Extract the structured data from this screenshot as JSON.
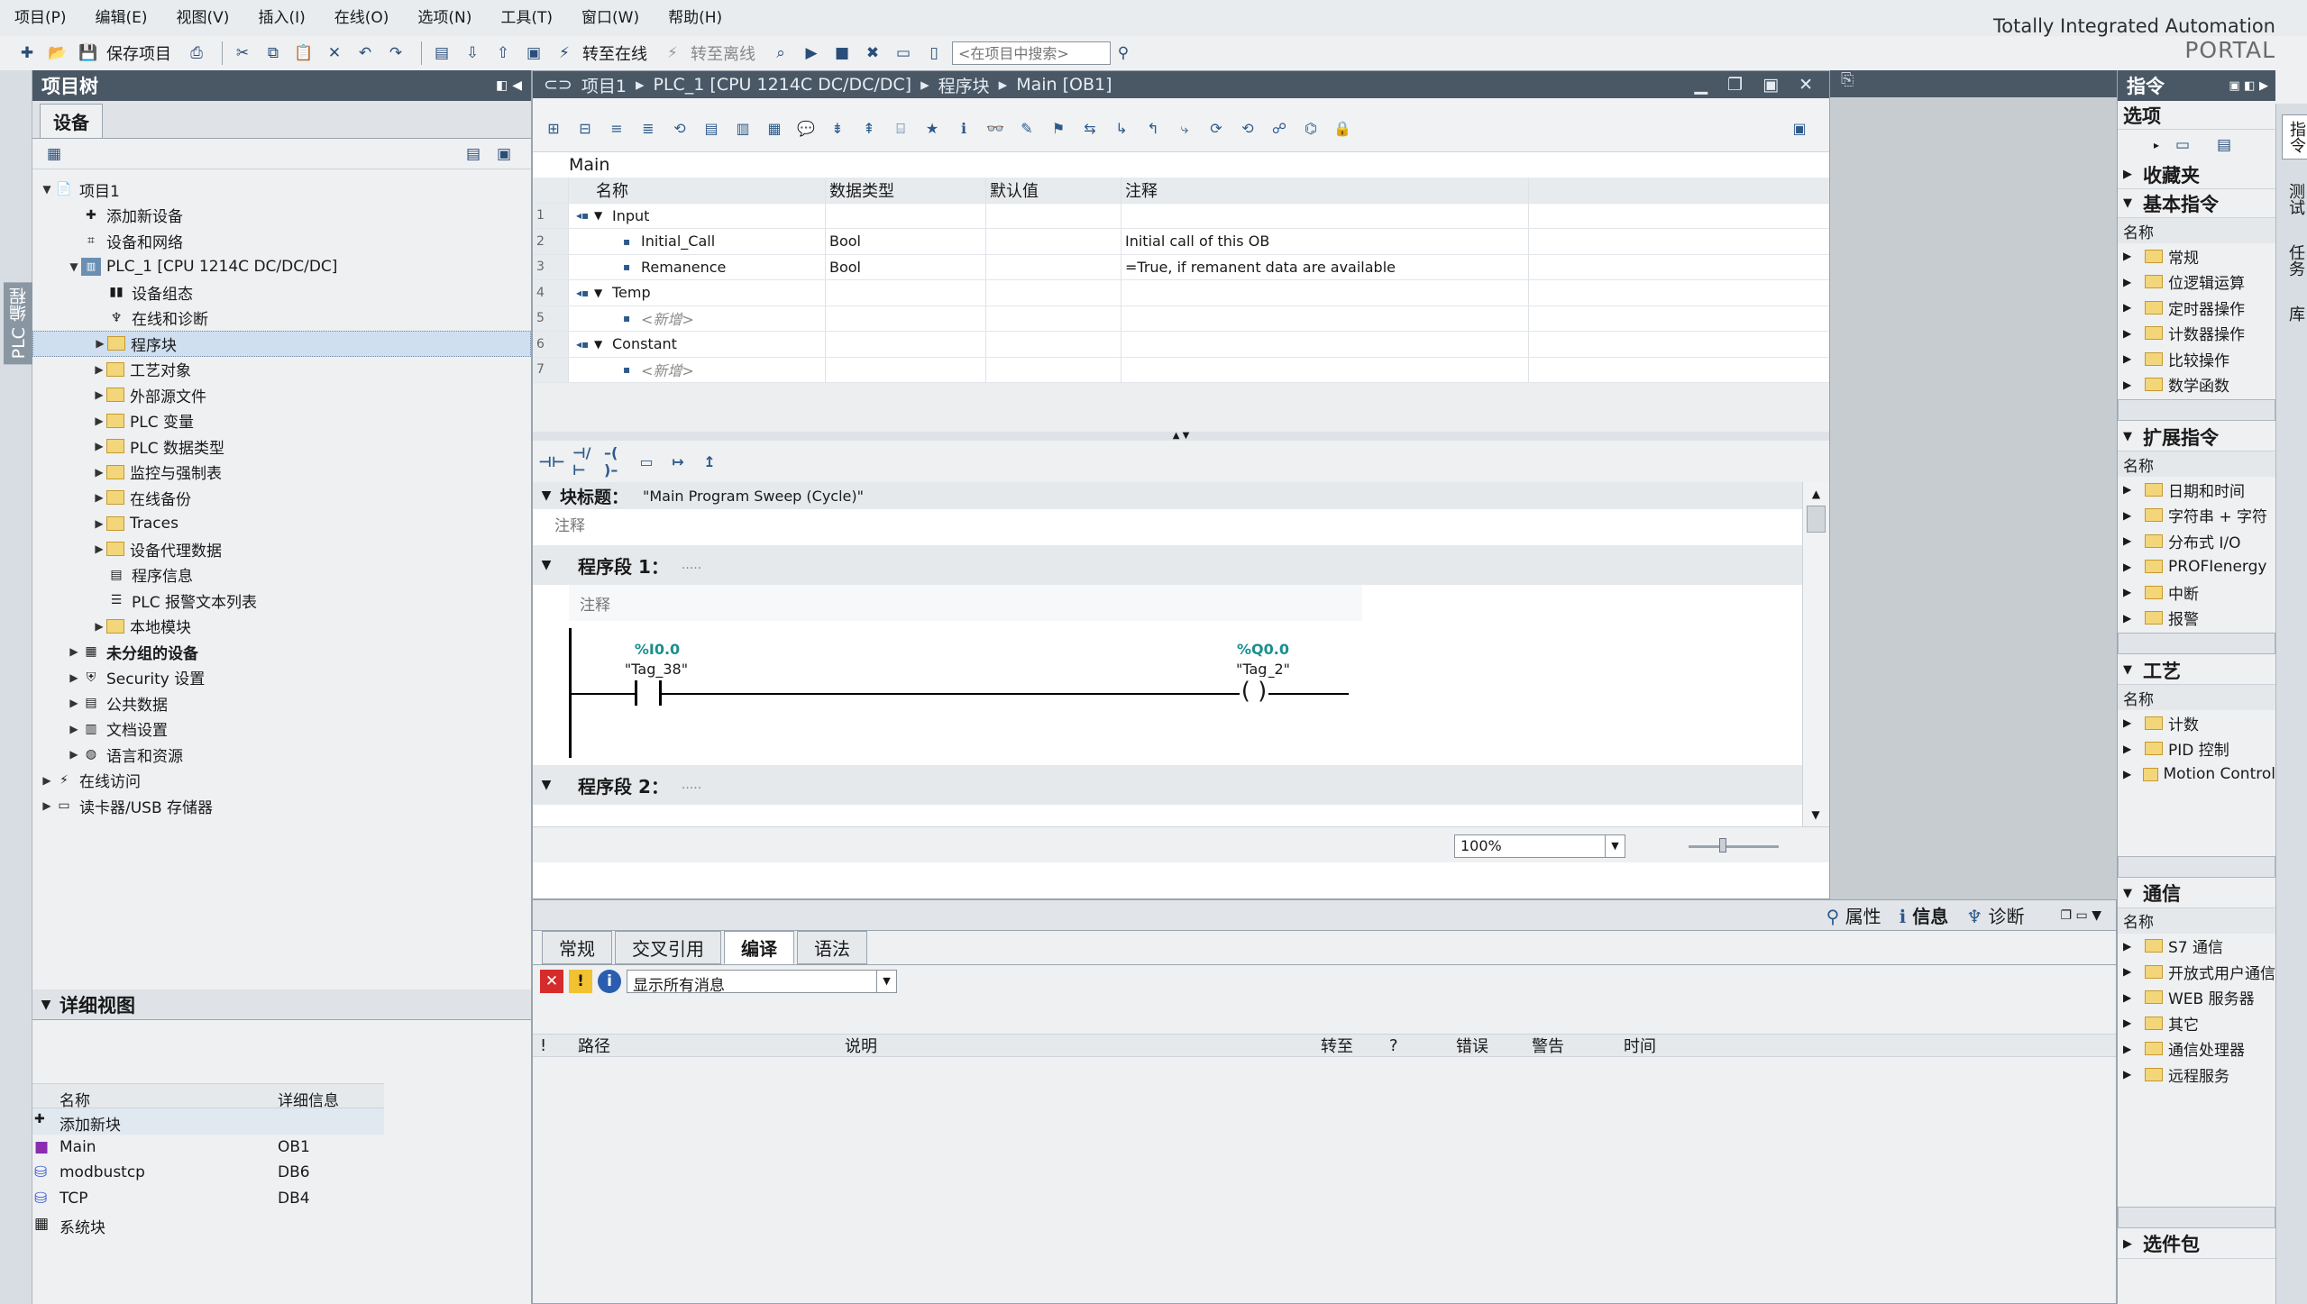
{
  "menu": [
    "项目(P)",
    "编辑(E)",
    "视图(V)",
    "插入(I)",
    "在线(O)",
    "选项(N)",
    "工具(T)",
    "窗口(W)",
    "帮助(H)"
  ],
  "brand": {
    "line1": "Totally Integrated Automation",
    "line2": "PORTAL"
  },
  "toolbar": {
    "save_label": "保存项目",
    "go_online": "转至在线",
    "go_offline": "转至离线",
    "search_placeholder": "<在项目中搜索>"
  },
  "side_strip_label": "PLC 编程",
  "project_tree": {
    "title": "项目树",
    "tab": "设备",
    "items": [
      "项目1",
      "添加新设备",
      "设备和网络",
      "PLC_1 [CPU 1214C DC/DC/DC]",
      "设备组态",
      "在线和诊断",
      "程序块",
      "工艺对象",
      "外部源文件",
      "PLC 变量",
      "PLC 数据类型",
      "监控与强制表",
      "在线备份",
      "Traces",
      "设备代理数据",
      "程序信息",
      "PLC 报警文本列表",
      "本地模块",
      "未分组的设备",
      "Security 设置",
      "公共数据",
      "文档设置",
      "语言和资源",
      "在线访问",
      "读卡器/USB 存储器"
    ]
  },
  "detail_view": {
    "title": "详细视图",
    "col_name": "名称",
    "col_info": "详细信息",
    "rows": [
      {
        "name": "添加新块",
        "info": ""
      },
      {
        "name": "Main",
        "info": "OB1"
      },
      {
        "name": "modbustcp",
        "info": "DB6"
      },
      {
        "name": "TCP",
        "info": "DB4"
      },
      {
        "name": "系统块",
        "info": ""
      }
    ]
  },
  "editor": {
    "breadcrumb": [
      "项目1",
      "PLC_1 [CPU 1214C DC/DC/DC]",
      "程序块",
      "Main [OB1]"
    ],
    "block_name": "Main",
    "columns": [
      "名称",
      "数据类型",
      "默认值",
      "注释"
    ],
    "rows": [
      {
        "n": "1",
        "name": "Input",
        "type": "",
        "default": "",
        "comment": ""
      },
      {
        "n": "2",
        "name": "Initial_Call",
        "type": "Bool",
        "default": "",
        "comment": "Initial call of this OB"
      },
      {
        "n": "3",
        "name": "Remanence",
        "type": "Bool",
        "default": "",
        "comment": "=True, if remanent data are available"
      },
      {
        "n": "4",
        "name": "Temp",
        "type": "",
        "default": "",
        "comment": ""
      },
      {
        "n": "5",
        "name": "<新增>",
        "type": "",
        "default": "",
        "comment": ""
      },
      {
        "n": "6",
        "name": "Constant",
        "type": "",
        "default": "",
        "comment": ""
      },
      {
        "n": "7",
        "name": "<新增>",
        "type": "",
        "default": "",
        "comment": ""
      }
    ],
    "block_title_label": "块标题：",
    "block_title": "\"Main Program Sweep (Cycle)\"",
    "comment": "注释",
    "network1": "程序段 1：",
    "network1_dots": ".....",
    "network2": "程序段 2：",
    "network2_dots": ".....",
    "contact_addr": "%I0.0",
    "contact_tag": "\"Tag_38\"",
    "coil_addr": "%Q0.0",
    "coil_tag": "\"Tag_2\"",
    "zoom": "100%"
  },
  "inspector": {
    "right_tabs": [
      "属性",
      "信息",
      "诊断"
    ],
    "tabs": [
      "常规",
      "交叉引用",
      "编译",
      "语法"
    ],
    "active_tab": "编译",
    "filter": "显示所有消息",
    "columns": [
      "!",
      "路径",
      "说明",
      "转至",
      "?",
      "错误",
      "警告",
      "时间"
    ]
  },
  "instructions": {
    "title": "指令",
    "options": "选项",
    "favorites": "收藏夹",
    "basic": {
      "title": "基本指令",
      "col": "名称",
      "items": [
        "常规",
        "位逻辑运算",
        "定时器操作",
        "计数器操作",
        "比较操作",
        "数学函数"
      ]
    },
    "extended": {
      "title": "扩展指令",
      "col": "名称",
      "items": [
        "日期和时间",
        "字符串 + 字符",
        "分布式 I/O",
        "PROFIenergy",
        "中断",
        "报警"
      ]
    },
    "tech": {
      "title": "工艺",
      "col": "名称",
      "items": [
        "计数",
        "PID 控制",
        "Motion Control"
      ]
    },
    "comm": {
      "title": "通信",
      "col": "名称",
      "items": [
        "S7 通信",
        "开放式用户通信",
        "WEB 服务器",
        "其它",
        "通信处理器",
        "远程服务"
      ]
    },
    "optional": "选件包"
  },
  "vertical_tabs": [
    "指令",
    "测试",
    "任务",
    "库"
  ]
}
